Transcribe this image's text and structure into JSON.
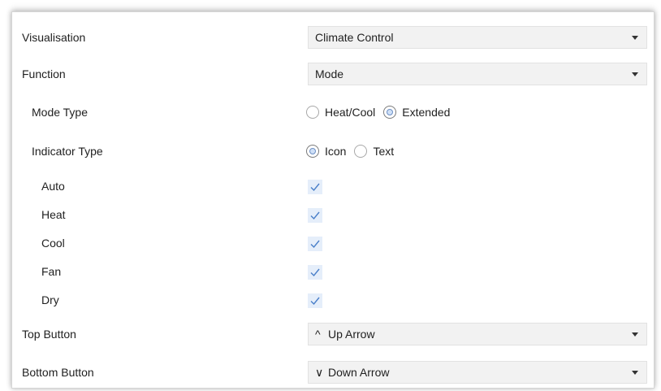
{
  "rows": {
    "visualisation": {
      "label": "Visualisation",
      "value": "Climate Control"
    },
    "function": {
      "label": "Function",
      "value": "Mode"
    },
    "mode_type": {
      "label": "Mode Type",
      "options": [
        "Heat/Cool",
        "Extended"
      ],
      "selected": "Extended"
    },
    "indicator_type": {
      "label": "Indicator Type",
      "options": [
        "Icon",
        "Text"
      ],
      "selected": "Icon"
    },
    "modes": [
      {
        "label": "Auto",
        "checked": true
      },
      {
        "label": "Heat",
        "checked": true
      },
      {
        "label": "Cool",
        "checked": true
      },
      {
        "label": "Fan",
        "checked": true
      },
      {
        "label": "Dry",
        "checked": true
      }
    ],
    "top_button": {
      "label": "Top Button",
      "icon": "^",
      "value": "Up Arrow"
    },
    "bottom_button": {
      "label": "Bottom Button",
      "icon": "∨",
      "value": "Down Arrow"
    }
  },
  "colors": {
    "dropdown_bg": "#f2f2f2",
    "check_bg": "#e5eefa",
    "check_mark": "#4a7fc9"
  }
}
